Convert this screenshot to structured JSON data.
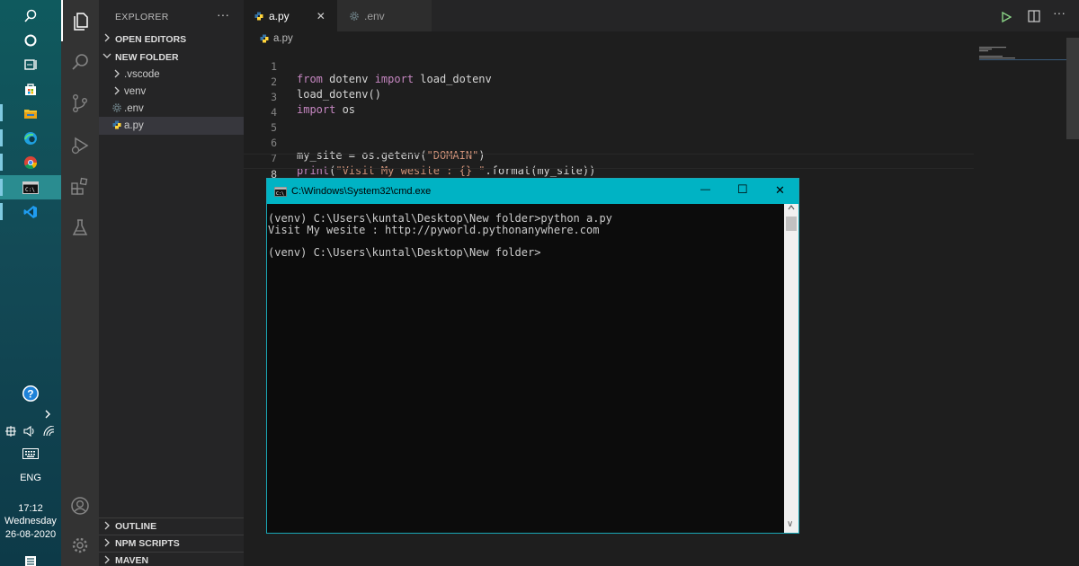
{
  "taskbar": {
    "time": "17:12",
    "day": "Wednesday",
    "date": "26-08-2020",
    "language": "ENG",
    "icons": [
      "search-icon",
      "cortana-icon",
      "task-view-icon",
      "store-icon",
      "file-explorer-icon",
      "edge-icon",
      "chrome-icon",
      "cmd-icon",
      "vscode-icon",
      "help-icon",
      "chevron-right-icon",
      "network-icon",
      "volume-icon",
      "wifi-icon",
      "keyboard-icon",
      "notification-icon"
    ]
  },
  "sidebar": {
    "title": "EXPLORER",
    "more": "···",
    "open_editors": "OPEN EDITORS",
    "folder": "NEW FOLDER",
    "items": [
      {
        "label": ".vscode",
        "type": "folder"
      },
      {
        "label": "venv",
        "type": "folder"
      },
      {
        "label": ".env",
        "type": "file"
      },
      {
        "label": "a.py",
        "type": "file"
      }
    ],
    "outline": "OUTLINE",
    "npm_scripts": "NPM SCRIPTS",
    "maven": "MAVEN"
  },
  "tabs": [
    {
      "label": "a.py",
      "close": "✕"
    },
    {
      "label": ".env"
    }
  ],
  "breadcrumb": "a.py",
  "code": {
    "line_numbers": [
      "1",
      "2",
      "3",
      "4",
      "5",
      "6",
      "7",
      "8"
    ],
    "l1": {
      "a": "from",
      "b": " dotenv ",
      "c": "import",
      "d": " load_dotenv"
    },
    "l2": "load_dotenv()",
    "l3": {
      "a": "import",
      "b": " os"
    },
    "l6": {
      "a": "my_site = os.getenv(",
      "b": "\"DOMAIN\"",
      "c": ")"
    },
    "l7": {
      "a": "print",
      "b": "(",
      "c": "\"Visit My wesite : {} \"",
      "d": ".format(my_site))"
    }
  },
  "cmd": {
    "title": "C:\\Windows\\System32\\cmd.exe",
    "minimize": "—",
    "maximize": "☐",
    "close": "✕",
    "lines": [
      "(venv) C:\\Users\\kuntal\\Desktop\\New folder>python a.py",
      "Visit My wesite : http://pyworld.pythonanywhere.com",
      "",
      "(venv) C:\\Users\\kuntal\\Desktop\\New folder>"
    ],
    "scroll_down": "∨"
  },
  "colors": {
    "cmd_title": "#00b3c4",
    "editor_bg": "#1e1e1e",
    "keyword": "#c586c0",
    "string": "#ce9178"
  }
}
